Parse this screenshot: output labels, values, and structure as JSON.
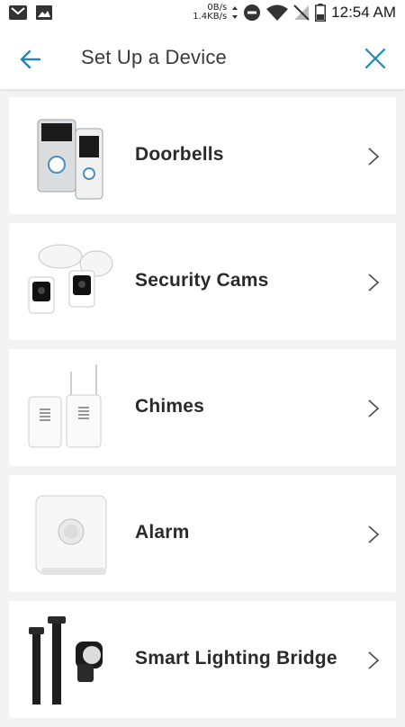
{
  "status_bar": {
    "upload_speed": "0B/s",
    "download_speed": "1.4KB/s",
    "time": "12:54 AM",
    "icons": [
      "gmail-icon",
      "photo-icon",
      "do-not-disturb-icon",
      "wifi-icon",
      "no-signal-icon",
      "battery-icon"
    ]
  },
  "header": {
    "title": "Set Up a Device",
    "back_icon": "arrow-left-icon",
    "close_icon": "close-icon",
    "accent_color": "#1e88b7"
  },
  "devices": [
    {
      "label": "Doorbells",
      "icon": "doorbell-icon"
    },
    {
      "label": "Security Cams",
      "icon": "security-cam-icon"
    },
    {
      "label": "Chimes",
      "icon": "chime-icon"
    },
    {
      "label": "Alarm",
      "icon": "alarm-icon"
    },
    {
      "label": "Smart Lighting Bridge",
      "icon": "lighting-bridge-icon"
    }
  ]
}
